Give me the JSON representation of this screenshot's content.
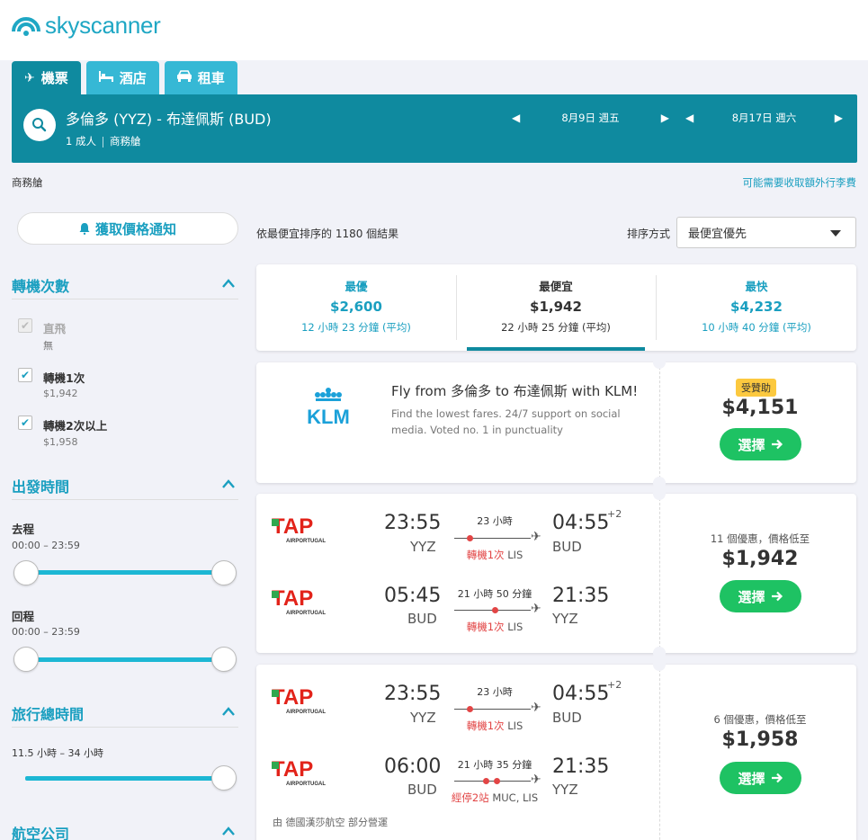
{
  "brand": {
    "name": "skyscanner"
  },
  "tabs": [
    {
      "label": "機票",
      "icon": "plane-icon",
      "active": true
    },
    {
      "label": "酒店",
      "icon": "bed-icon",
      "active": false
    },
    {
      "label": "租車",
      "icon": "car-icon",
      "active": false
    }
  ],
  "search": {
    "route": "多倫多 (YYZ) - 布達佩斯 (BUD)",
    "passengers": "1 成人",
    "cabin": "商務艙",
    "depart_date": "8月9日 週五",
    "return_date": "8月17日 週六"
  },
  "subheader": {
    "cabin_label": "商務艙",
    "fees_link": "可能需要收取額外行李費"
  },
  "sidebar": {
    "price_alert": "獲取價格通知",
    "stops": {
      "title": "轉機次數",
      "options": [
        {
          "label": "直飛",
          "sub": "無",
          "checked": true,
          "disabled": true
        },
        {
          "label": "轉機1次",
          "sub": "$1,942",
          "checked": true,
          "disabled": false
        },
        {
          "label": "轉機2次以上",
          "sub": "$1,958",
          "checked": true,
          "disabled": false
        }
      ]
    },
    "departure_times": {
      "title": "出發時間",
      "outbound_label": "去程",
      "outbound_range": "00:00 – 23:59",
      "return_label": "回程",
      "return_range": "00:00 – 23:59"
    },
    "duration": {
      "title": "旅行總時間",
      "range": "11.5 小時 – 34 小時"
    },
    "airlines": {
      "title": "航空公司"
    }
  },
  "results": {
    "count_text": "依最便宜排序的 1180 個結果",
    "sort_label": "排序方式",
    "sort_value": "最便宜優先"
  },
  "summary": [
    {
      "label": "最優",
      "price": "$2,600",
      "duration": "12 小時 23 分鐘 (平均)"
    },
    {
      "label": "最便宜",
      "price": "$1,942",
      "duration": "22 小時 25 分鐘 (平均)"
    },
    {
      "label": "最快",
      "price": "$4,232",
      "duration": "10 小時 40 分鐘 (平均)"
    }
  ],
  "ad": {
    "airline": "KLM",
    "headline": "Fly from 多倫多 to 布達佩斯 with KLM!",
    "body_line1": "Find the lowest fares. 24/7 support on social",
    "body_line2": "media. Voted no. 1 in punctuality",
    "badge": "受贊助",
    "price": "$4,151",
    "button": "選擇"
  },
  "itineraries": [
    {
      "deals": "11 個優惠，價格低至",
      "price": "$1,942",
      "button": "選擇",
      "legs": [
        {
          "airline": "AIRPORTUGAL",
          "dep_time": "23:55",
          "dep_code": "YYZ",
          "arr_time": "04:55",
          "arr_code": "BUD",
          "plus": "+2",
          "duration": "23 小時",
          "stops": "轉機1次",
          "via": "LIS"
        },
        {
          "airline": "AIRPORTUGAL",
          "dep_time": "05:45",
          "dep_code": "BUD",
          "arr_time": "21:35",
          "arr_code": "YYZ",
          "plus": "",
          "duration": "21 小時 50 分鐘",
          "stops": "轉機1次",
          "via": "LIS"
        }
      ]
    },
    {
      "deals": "6 個優惠，價格低至",
      "price": "$1,958",
      "button": "選擇",
      "operated_by": "由 德國漢莎航空 部分營運",
      "legs": [
        {
          "airline": "AIRPORTUGAL",
          "dep_time": "23:55",
          "dep_code": "YYZ",
          "arr_time": "04:55",
          "arr_code": "BUD",
          "plus": "+2",
          "duration": "23 小時",
          "stops": "轉機1次",
          "via": "LIS"
        },
        {
          "airline": "AIRPORTUGAL",
          "dep_time": "06:00",
          "dep_code": "BUD",
          "arr_time": "21:35",
          "arr_code": "YYZ",
          "plus": "",
          "duration": "21 小時 35 分鐘",
          "stops": "經停2站",
          "via": "MUC, LIS"
        }
      ]
    }
  ],
  "colors": {
    "brand": "#1fa7c4",
    "tab_active": "#0f8a9f",
    "tab": "#36b8d5",
    "select_button": "#1ec263",
    "stop_red": "#e24545",
    "sponsor": "#fcc93f"
  }
}
